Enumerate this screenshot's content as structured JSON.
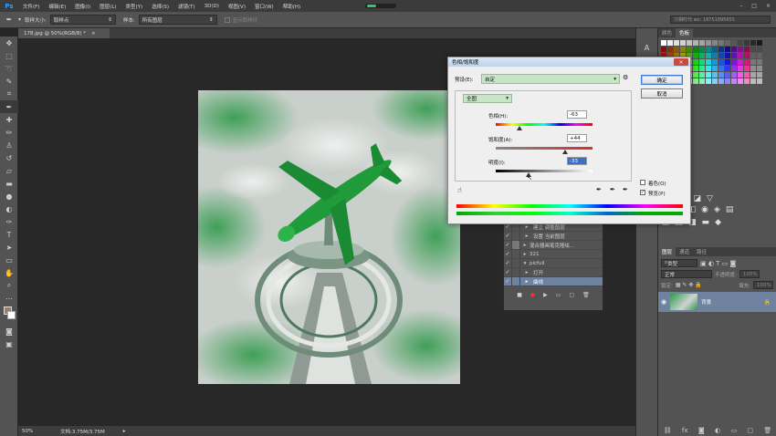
{
  "app": {
    "logo": "Ps"
  },
  "menu": [
    "文件(F)",
    "编辑(E)",
    "图像(I)",
    "图层(L)",
    "类型(Y)",
    "选择(S)",
    "滤镜(T)",
    "3D(D)",
    "视图(V)",
    "窗口(W)",
    "帮助(H)"
  ],
  "options_bar": {
    "sample_size_label": "取样大小:",
    "sample_size_value": "取样点",
    "sample_label": "样本:",
    "sample_value": "所有图层",
    "show_ring_label": "显示取样环"
  },
  "user": {
    "name": "习相时代 wx: 18751895655"
  },
  "document": {
    "tab_title": "178.jpg @ 50%(RGB/8) *",
    "close": "×"
  },
  "status": {
    "zoom": "50%",
    "doc_info": "文档:3.75M/3.75M"
  },
  "dialog": {
    "title": "色相/饱和度",
    "preset_label": "预设(E):",
    "preset_value": "自定",
    "ok": "确定",
    "cancel": "取消",
    "channel": "全图",
    "hue_label": "色相(H):",
    "hue_value": "-63",
    "sat_label": "饱和度(A):",
    "sat_value": "+44",
    "light_label": "明度(I):",
    "light_value": "-33",
    "colorize_label": "着色(O)",
    "preview_label": "预览(P)",
    "preview_checked": "✓"
  },
  "actions": {
    "rows": [
      {
        "label": "建立 调整图层",
        "check": "✓"
      },
      {
        "label": "设置 当前图层",
        "check": "✓"
      },
      {
        "label": "混合器画笔克隆绘...",
        "check": "✓"
      },
      {
        "label": "321",
        "check": "✓"
      },
      {
        "label": "picfull",
        "check": "✓"
      },
      {
        "label": "打开",
        "check": "✓"
      },
      {
        "label": "曲线",
        "check": "✓"
      }
    ]
  },
  "right_panel": {
    "tabs_top": [
      "颜色",
      "色板"
    ],
    "tabs_layers": [
      "图层",
      "通道",
      "路径"
    ],
    "kind_label": "类型",
    "blend_mode": "正常",
    "opacity_label": "不透明度:",
    "opacity_value": "100%",
    "lock_label": "锁定:",
    "fill_label": "填充:",
    "fill_value": "100%",
    "layer_name": "背景"
  },
  "colors": {
    "accent": "#2fa3ff",
    "panel": "#535353",
    "dark": "#3b3b3b"
  }
}
